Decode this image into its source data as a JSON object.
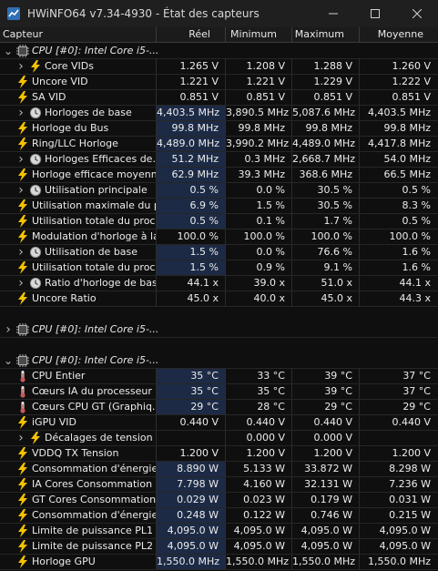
{
  "window": {
    "title": "HWiNFO64 v7.34-4930 - État des capteurs"
  },
  "columns": {
    "sensor": "Capteur",
    "real": "Réel",
    "min": "Minimum",
    "max": "Maximum",
    "avg": "Moyenne"
  },
  "rows": [
    {
      "kind": "group",
      "indent": 0,
      "expander": "v",
      "icon": "chip",
      "label": "CPU [#0]: Intel Core i5-..."
    },
    {
      "kind": "sensor",
      "indent": 1,
      "expander": ">",
      "icon": "bolt",
      "label": "Core VIDs",
      "real": "1.265 V",
      "min": "1.208 V",
      "max": "1.288 V",
      "avg": "1.260 V",
      "hl": false
    },
    {
      "kind": "sensor",
      "indent": 0,
      "expander": "",
      "icon": "bolt",
      "label": "Uncore VID",
      "real": "1.221 V",
      "min": "1.221 V",
      "max": "1.229 V",
      "avg": "1.222 V",
      "hl": false
    },
    {
      "kind": "sensor",
      "indent": 0,
      "expander": "",
      "icon": "bolt",
      "label": "SA VID",
      "real": "0.851 V",
      "min": "0.851 V",
      "max": "0.851 V",
      "avg": "0.851 V",
      "hl": false
    },
    {
      "kind": "sensor",
      "indent": 1,
      "expander": ">",
      "icon": "clock",
      "label": "Horloges de base",
      "real": "4,403.5 MHz",
      "min": "3,890.5 MHz",
      "max": "5,087.6 MHz",
      "avg": "4,403.5 MHz",
      "hl": true
    },
    {
      "kind": "sensor",
      "indent": 0,
      "expander": "",
      "icon": "bolt",
      "label": "Horloge du Bus",
      "real": "99.8 MHz",
      "min": "99.8 MHz",
      "max": "99.8 MHz",
      "avg": "99.8 MHz",
      "hl": true
    },
    {
      "kind": "sensor",
      "indent": 0,
      "expander": "",
      "icon": "bolt",
      "label": "Ring/LLC Horloge",
      "real": "4,489.0 MHz",
      "min": "3,990.2 MHz",
      "max": "4,489.0 MHz",
      "avg": "4,417.8 MHz",
      "hl": true
    },
    {
      "kind": "sensor",
      "indent": 1,
      "expander": ">",
      "icon": "clock",
      "label": "Horloges Efficaces de...",
      "real": "51.2 MHz",
      "min": "0.3 MHz",
      "max": "2,668.7 MHz",
      "avg": "54.0 MHz",
      "hl": true
    },
    {
      "kind": "sensor",
      "indent": 0,
      "expander": "",
      "icon": "bolt",
      "label": "Horloge efficace moyenne",
      "real": "62.9 MHz",
      "min": "39.3 MHz",
      "max": "368.6 MHz",
      "avg": "66.5 MHz",
      "hl": true
    },
    {
      "kind": "sensor",
      "indent": 1,
      "expander": ">",
      "icon": "clock",
      "label": "Utilisation principale",
      "real": "0.5 %",
      "min": "0.0 %",
      "max": "30.5 %",
      "avg": "0.5 %",
      "hl": true
    },
    {
      "kind": "sensor",
      "indent": 0,
      "expander": "",
      "icon": "bolt",
      "label": "Utilisation maximale du p...",
      "real": "6.9 %",
      "min": "1.5 %",
      "max": "30.5 %",
      "avg": "8.3 %",
      "hl": true
    },
    {
      "kind": "sensor",
      "indent": 0,
      "expander": "",
      "icon": "bolt",
      "label": "Utilisation totale du proc...",
      "real": "0.5 %",
      "min": "0.1 %",
      "max": "1.7 %",
      "avg": "0.5 %",
      "hl": true
    },
    {
      "kind": "sensor",
      "indent": 0,
      "expander": "",
      "icon": "bolt",
      "label": "Modulation d'horloge à la...",
      "real": "100.0 %",
      "min": "100.0 %",
      "max": "100.0 %",
      "avg": "100.0 %",
      "hl": false
    },
    {
      "kind": "sensor",
      "indent": 1,
      "expander": ">",
      "icon": "clock",
      "label": "Utilisation de base",
      "real": "1.5 %",
      "min": "0.0 %",
      "max": "76.6 %",
      "avg": "1.6 %",
      "hl": true
    },
    {
      "kind": "sensor",
      "indent": 0,
      "expander": "",
      "icon": "bolt",
      "label": "Utilisation totale du proc...",
      "real": "1.5 %",
      "min": "0.9 %",
      "max": "9.1 %",
      "avg": "1.6 %",
      "hl": true
    },
    {
      "kind": "sensor",
      "indent": 1,
      "expander": ">",
      "icon": "clock",
      "label": "Ratio d'horloge de base",
      "real": "44.1 x",
      "min": "39.0 x",
      "max": "51.0 x",
      "avg": "44.1 x",
      "hl": false
    },
    {
      "kind": "sensor",
      "indent": 0,
      "expander": "",
      "icon": "bolt",
      "label": "Uncore Ratio",
      "real": "45.0 x",
      "min": "40.0 x",
      "max": "45.0 x",
      "avg": "44.3 x",
      "hl": false
    },
    {
      "kind": "blank"
    },
    {
      "kind": "group",
      "indent": 0,
      "expander": ">",
      "icon": "chip",
      "label": "CPU [#0]: Intel Core i5-..."
    },
    {
      "kind": "blank"
    },
    {
      "kind": "group",
      "indent": 0,
      "expander": "v",
      "icon": "chip",
      "label": "CPU [#0]: Intel Core i5-..."
    },
    {
      "kind": "sensor",
      "indent": 0,
      "expander": "",
      "icon": "thermo",
      "label": "CPU Entier",
      "real": "35 °C",
      "min": "33 °C",
      "max": "39 °C",
      "avg": "37 °C",
      "hl": true
    },
    {
      "kind": "sensor",
      "indent": 0,
      "expander": "",
      "icon": "thermo",
      "label": "Cœurs IA du processeur",
      "real": "35 °C",
      "min": "35 °C",
      "max": "39 °C",
      "avg": "37 °C",
      "hl": true
    },
    {
      "kind": "sensor",
      "indent": 0,
      "expander": "",
      "icon": "thermo",
      "label": "Cœurs CPU GT (Graphiq...",
      "real": "29 °C",
      "min": "28 °C",
      "max": "29 °C",
      "avg": "29 °C",
      "hl": true
    },
    {
      "kind": "sensor",
      "indent": 0,
      "expander": "",
      "icon": "bolt",
      "label": "iGPU VID",
      "real": "0.440 V",
      "min": "0.440 V",
      "max": "0.440 V",
      "avg": "0.440 V",
      "hl": false
    },
    {
      "kind": "sensor",
      "indent": 1,
      "expander": ">",
      "icon": "bolt",
      "label": "Décalages de tension",
      "real": "",
      "min": "0.000 V",
      "max": "0.000 V",
      "avg": "",
      "hl": false
    },
    {
      "kind": "sensor",
      "indent": 0,
      "expander": "",
      "icon": "bolt",
      "label": "VDDQ TX Tension",
      "real": "1.200 V",
      "min": "1.200 V",
      "max": "1.200 V",
      "avg": "1.200 V",
      "hl": false
    },
    {
      "kind": "sensor",
      "indent": 0,
      "expander": "",
      "icon": "bolt",
      "label": "Consommation d'énergie...",
      "real": "8.890 W",
      "min": "5.133 W",
      "max": "33.872 W",
      "avg": "8.298 W",
      "hl": true
    },
    {
      "kind": "sensor",
      "indent": 0,
      "expander": "",
      "icon": "bolt",
      "label": "IA Cores Consommation ...",
      "real": "7.798 W",
      "min": "4.160 W",
      "max": "32.131 W",
      "avg": "7.236 W",
      "hl": true
    },
    {
      "kind": "sensor",
      "indent": 0,
      "expander": "",
      "icon": "bolt",
      "label": "GT Cores Consommation...",
      "real": "0.029 W",
      "min": "0.023 W",
      "max": "0.179 W",
      "avg": "0.031 W",
      "hl": true
    },
    {
      "kind": "sensor",
      "indent": 0,
      "expander": "",
      "icon": "bolt",
      "label": "Consommation d'énergie...",
      "real": "0.248 W",
      "min": "0.122 W",
      "max": "0.746 W",
      "avg": "0.215 W",
      "hl": true
    },
    {
      "kind": "sensor",
      "indent": 0,
      "expander": "",
      "icon": "bolt",
      "label": "Limite de puissance PL1",
      "real": "4,095.0 W",
      "min": "4,095.0 W",
      "max": "4,095.0 W",
      "avg": "4,095.0 W",
      "hl": true
    },
    {
      "kind": "sensor",
      "indent": 0,
      "expander": "",
      "icon": "bolt",
      "label": "Limite de puissance PL2",
      "real": "4,095.0 W",
      "min": "4,095.0 W",
      "max": "4,095.0 W",
      "avg": "4,095.0 W",
      "hl": true
    },
    {
      "kind": "sensor",
      "indent": 0,
      "expander": "",
      "icon": "bolt",
      "label": "Horloge GPU",
      "real": "1,550.0 MHz",
      "min": "1,550.0 MHz",
      "max": "1,550.0 MHz",
      "avg": "1,550.0 MHz",
      "hl": true
    }
  ],
  "colors": {
    "background": "#0f0f0f",
    "titlebar": "#1f1f1f",
    "text": "#ececec",
    "highlight": "#1c2a45",
    "bolt": "#f5c200",
    "thermo": "#c75a5a"
  }
}
